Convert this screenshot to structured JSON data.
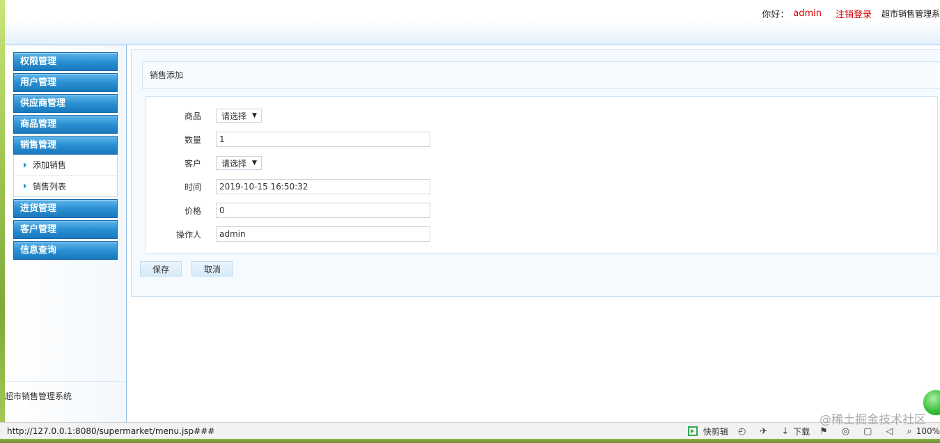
{
  "header": {
    "greeting": "你好：",
    "username": "admin",
    "logout_label": "注销登录",
    "system_name": "超市销售管理系"
  },
  "sidebar": {
    "menu": [
      {
        "label": "权限管理"
      },
      {
        "label": "用户管理"
      },
      {
        "label": "供应商管理"
      },
      {
        "label": "商品管理"
      },
      {
        "label": "销售管理",
        "expanded": true,
        "children": [
          {
            "label": "添加销售"
          },
          {
            "label": "销售列表"
          }
        ]
      },
      {
        "label": "进货管理"
      },
      {
        "label": "客户管理"
      },
      {
        "label": "信息查询"
      }
    ],
    "footer": "超市销售管理系统"
  },
  "main": {
    "panel_title": "销售添加",
    "form": {
      "product": {
        "label": "商品",
        "value": "请选择"
      },
      "quantity": {
        "label": "数量",
        "value": "1"
      },
      "customer": {
        "label": "客户",
        "value": "请选择"
      },
      "time": {
        "label": "时间",
        "value": "2019-10-15 16:50:32"
      },
      "price": {
        "label": "价格",
        "value": "0"
      },
      "operator": {
        "label": "操作人",
        "value": "admin"
      }
    },
    "save_label": "保存",
    "cancel_label": "取消"
  },
  "statusbar": {
    "url": "http://127.0.0.1:8080/supermarket/menu.jsp###",
    "quick_clip_label": "快剪辑",
    "download_label": "下载",
    "zoom": "100%"
  },
  "watermark": "@稀土掘金技术社区",
  "colors": {
    "menu_blue": "#2a90d2",
    "highlight_red": "#d40000",
    "panel_bg": "#f5faff"
  }
}
